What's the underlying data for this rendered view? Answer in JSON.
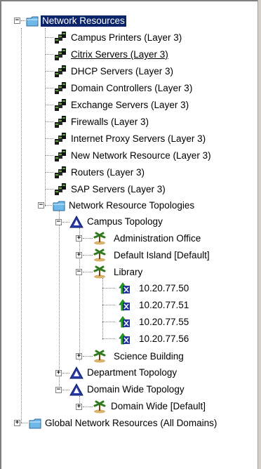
{
  "tree": {
    "root": {
      "label": "Network Resources",
      "icon": "folder-icon",
      "expanded": true,
      "selected": true
    },
    "network_resources": [
      {
        "label": "Campus Printers (Layer 3)",
        "icon": "network-group-icon"
      },
      {
        "label": "Citrix Servers (Layer 3)",
        "icon": "network-group-icon"
      },
      {
        "label": "DHCP Servers (Layer 3)",
        "icon": "network-group-icon"
      },
      {
        "label": "Domain Controllers (Layer 3)",
        "icon": "network-group-icon"
      },
      {
        "label": "Exchange Servers (Layer 3)",
        "icon": "network-group-icon"
      },
      {
        "label": "Firewalls (Layer 3)",
        "icon": "network-group-icon"
      },
      {
        "label": "Internet Proxy Servers (Layer 3)",
        "icon": "network-group-icon"
      },
      {
        "label": "New Network Resource (Layer 3)",
        "icon": "network-group-icon"
      },
      {
        "label": "Routers (Layer 3)",
        "icon": "network-group-icon"
      },
      {
        "label": "SAP Servers (Layer 3)",
        "icon": "network-group-icon"
      }
    ],
    "topologies": {
      "label": "Network Resource Topologies",
      "icon": "folder-icon",
      "campus": {
        "label": "Campus Topology",
        "icon": "topology-icon",
        "children": [
          {
            "label": "Administration Office",
            "icon": "island-icon"
          },
          {
            "label": "Default Island [Default]",
            "icon": "island-icon"
          },
          {
            "label": "Library",
            "icon": "island-icon"
          },
          {
            "label": "Science Building",
            "icon": "island-icon"
          }
        ],
        "library_hosts": [
          {
            "label": "10.20.77.50",
            "icon": "host-icon"
          },
          {
            "label": "10.20.77.51",
            "icon": "host-icon"
          },
          {
            "label": "10.20.77.55",
            "icon": "host-icon"
          },
          {
            "label": "10.20.77.56",
            "icon": "host-icon"
          }
        ]
      },
      "department": {
        "label": "Department Topology",
        "icon": "topology-icon"
      },
      "domain_wide": {
        "label": "Domain Wide Topology",
        "icon": "topology-icon",
        "children": [
          {
            "label": "Domain Wide [Default]",
            "icon": "island-icon"
          }
        ]
      }
    },
    "global": {
      "label": "Global Network Resources (All Domains)",
      "icon": "folder-icon"
    }
  },
  "colors": {
    "selection": "#0a246a",
    "folder": "#6fb8e8",
    "topology": "#2a3aa8",
    "host_arrow": "#1fa81f",
    "host_box": "#1c2f9a",
    "island_tree": "#2f7a1f"
  }
}
